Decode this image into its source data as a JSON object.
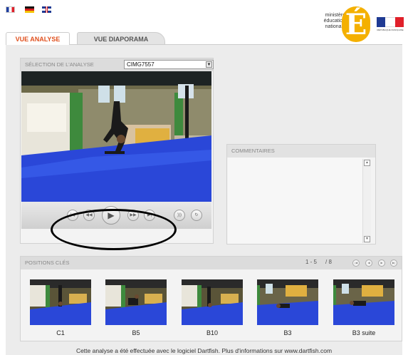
{
  "languages": [
    {
      "code": "fr",
      "icon": "flag-fr-icon"
    },
    {
      "code": "de",
      "icon": "flag-de-icon"
    },
    {
      "code": "en",
      "icon": "flag-gb-icon"
    }
  ],
  "logo": {
    "lines": [
      "ministère",
      "éducation",
      "nationale"
    ],
    "letter": "É",
    "rf_text": "RÉPUBLIQUE FRANÇAISE"
  },
  "tabs": [
    {
      "label": "VUE ANALYSE",
      "active": true
    },
    {
      "label": "VUE DIAPORAMA",
      "active": false
    }
  ],
  "analysis": {
    "header": "SÉLECTION DE L'ANALYSE",
    "selected_clip": "CIMG7557",
    "controls": [
      "skip-start-icon",
      "rewind-icon",
      "play-icon",
      "fast-forward-icon",
      "skip-end-icon",
      "audio-icon",
      "loop-icon"
    ],
    "control_glyphs": [
      "|◀",
      "◀◀",
      "▶",
      "▶▶",
      "▶|",
      ")))",
      "↻"
    ]
  },
  "comments": {
    "header": "COMMENTAIRES",
    "text": ""
  },
  "key_positions": {
    "header": "POSITIONS CLÉS",
    "range": "1 - 5",
    "total": "/ 8",
    "items": [
      {
        "label": "C1"
      },
      {
        "label": "B5"
      },
      {
        "label": "B10"
      },
      {
        "label": "B3"
      },
      {
        "label": "B3 suite"
      }
    ]
  },
  "footer": "Cette analyse a été effectuée avec le logiciel Dartfish. Plus d'informations sur www.dartfish.com",
  "colors": {
    "active_tab": "#e0501e",
    "mat": "#2a47d8",
    "logo": "#f4b000"
  }
}
